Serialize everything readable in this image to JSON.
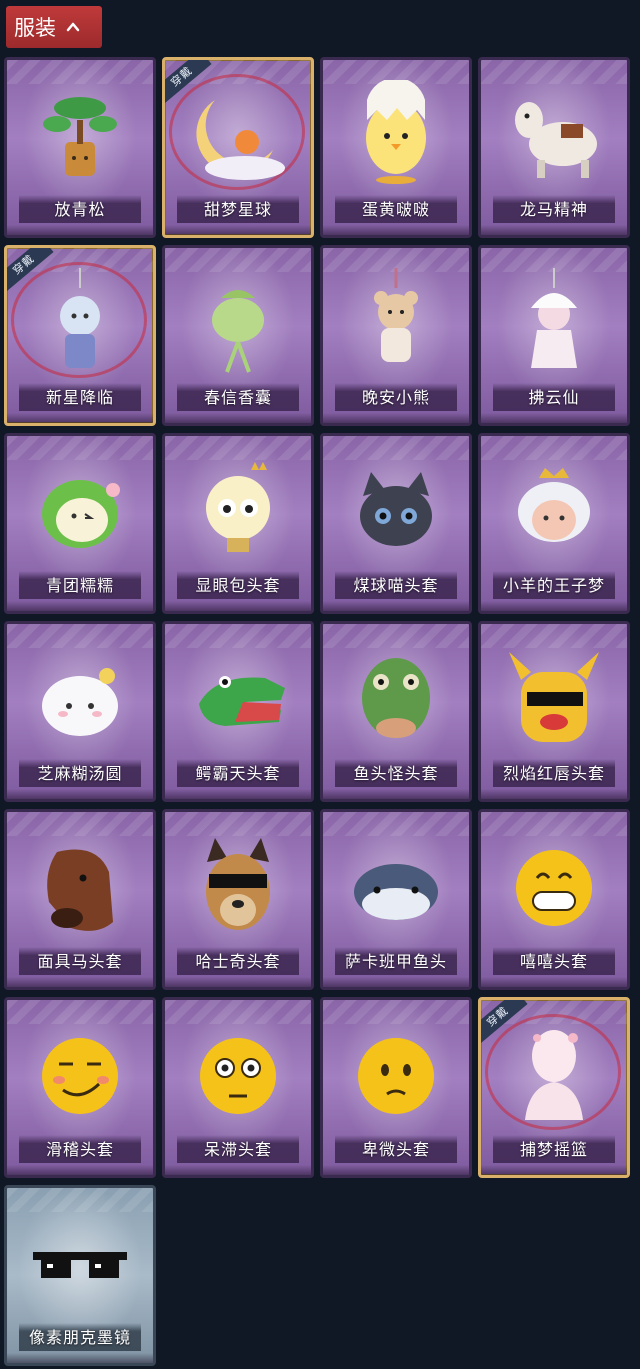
{
  "header": {
    "tab_label": "服装",
    "tab_icon": "chevron-up-icon",
    "accent_color": "#b03435"
  },
  "items": [
    {
      "name": "放青松",
      "icon": "bonsai-pine-tree",
      "equipped": false
    },
    {
      "name": "甜梦星球",
      "icon": "moon-dream-fox",
      "equipped": true
    },
    {
      "name": "蛋黄啵啵",
      "icon": "yellow-chick-in-egg",
      "equipped": false
    },
    {
      "name": "龙马精神",
      "icon": "white-horse-plush",
      "equipped": false
    },
    {
      "name": "新星降临",
      "icon": "star-girl-keychain",
      "equipped": true
    },
    {
      "name": "春信香囊",
      "icon": "green-sachet-pendant",
      "equipped": false
    },
    {
      "name": "晚安小熊",
      "icon": "bear-keychain",
      "equipped": false
    },
    {
      "name": "拂云仙",
      "icon": "cloud-fairy-keychain",
      "equipped": false
    },
    {
      "name": "青团糯糯",
      "icon": "green-rice-ball-head",
      "equipped": false
    },
    {
      "name": "显眼包头套",
      "icon": "lightbulb-head",
      "equipped": false
    },
    {
      "name": "煤球喵头套",
      "icon": "black-cat-head",
      "equipped": false
    },
    {
      "name": "小羊的王子梦",
      "icon": "sheep-prince-head",
      "equipped": false
    },
    {
      "name": "芝麻糊汤圆",
      "icon": "white-dumpling-head",
      "equipped": false
    },
    {
      "name": "鳄霸天头套",
      "icon": "crocodile-head",
      "equipped": false
    },
    {
      "name": "鱼头怪头套",
      "icon": "fish-head",
      "equipped": false
    },
    {
      "name": "烈焰红唇头套",
      "icon": "pikachu-sunglasses-head",
      "equipped": false
    },
    {
      "name": "面具马头套",
      "icon": "horse-mask-head",
      "equipped": false
    },
    {
      "name": "哈士奇头套",
      "icon": "husky-sunglasses-head",
      "equipped": false
    },
    {
      "name": "萨卡班甲鱼头",
      "icon": "sacabambaspis-head",
      "equipped": false
    },
    {
      "name": "嘻嘻头套",
      "icon": "grinning-emoji-head",
      "equipped": false
    },
    {
      "name": "滑稽头套",
      "icon": "smirk-emoji-head",
      "equipped": false
    },
    {
      "name": "呆滞头套",
      "icon": "stunned-emoji-head",
      "equipped": false
    },
    {
      "name": "卑微头套",
      "icon": "pleading-emoji-head",
      "equipped": false
    },
    {
      "name": "捕梦摇篮",
      "icon": "dream-mannequin",
      "equipped": true
    },
    {
      "name": "像素朋克墨镜",
      "icon": "pixel-sunglasses",
      "equipped": false,
      "grey": true
    }
  ],
  "badge_text": "穿戴"
}
